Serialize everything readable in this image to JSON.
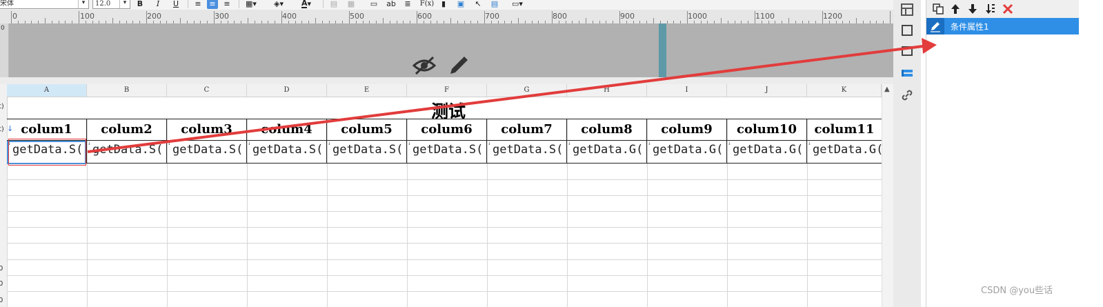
{
  "toolbar": {
    "font_name": "宋体",
    "font_size": "12.0",
    "bold": "B",
    "italic": "I",
    "underline": "U",
    "text_a": "A",
    "text_ab": "ab",
    "text_fx": "F(x)"
  },
  "ruler": {
    "labels": [
      "0",
      "100",
      "200",
      "300",
      "400",
      "500",
      "600",
      "700",
      "800",
      "900",
      "1000",
      "1100",
      "1200"
    ]
  },
  "band_left_label": "0",
  "sheet": {
    "col_headers": [
      "A",
      "B",
      "C",
      "D",
      "E",
      "F",
      "G",
      "H",
      "I",
      "J",
      "K"
    ],
    "row_labels": [
      "t)",
      "t)",
      "0",
      "0",
      "0"
    ],
    "title": "测试",
    "header_row": [
      "colum1",
      "colum2",
      "colum3",
      "colum4",
      "colum5",
      "colum6",
      "colum7",
      "colum8",
      "colum9",
      "colum10",
      "colum11"
    ],
    "data_row": [
      "getData.S(",
      "getData.S(",
      "getData.S(",
      "getData.S(",
      "getData.S(",
      "getData.S(",
      "getData.S(",
      "getData.G(",
      "getData.G(",
      "getData.G(",
      "getData.G("
    ],
    "row_arrow": "↓"
  },
  "panel": {
    "condition_item": "条件属性1"
  },
  "watermark": "CSDN @you些话",
  "colors": {
    "accent": "#2f8fe6",
    "annotation_red": "#e23c3c",
    "band_gray": "#b1b1b1",
    "marker_teal": "#5d99a6"
  }
}
